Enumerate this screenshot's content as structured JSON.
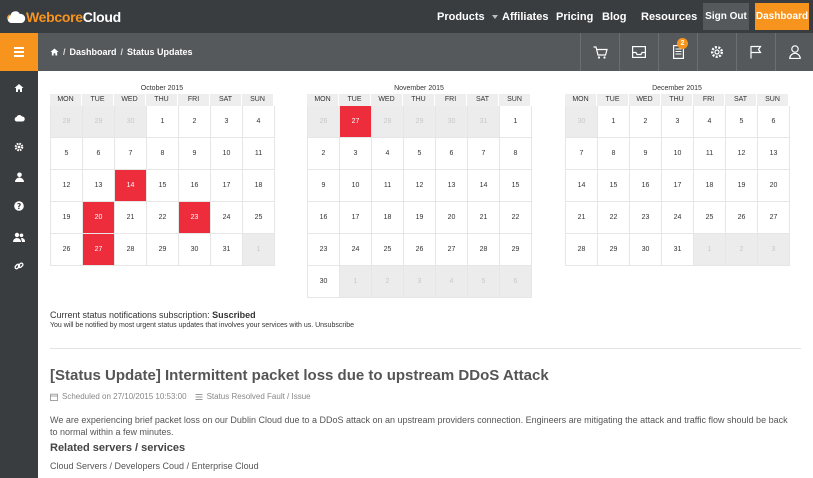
{
  "brand": {
    "word1": "Webcore",
    "word2": "Cloud"
  },
  "nav": {
    "products": "Products",
    "affiliates": "Affiliates",
    "pricing": "Pricing",
    "blog": "Blog",
    "resources": "Resources",
    "signout": "Sign Out",
    "dashboard": "Dashboard"
  },
  "breadcrumb": {
    "home_sep": "/",
    "dashboard": "Dashboard",
    "sep": "/",
    "current": "Status Updates"
  },
  "notifications_badge": "2",
  "colors": {
    "accent": "#f7941d",
    "dark": "#3a3d40",
    "mid": "#55595c",
    "highlight": "#ee2d3c"
  },
  "weekdays": [
    "MON",
    "TUE",
    "WED",
    "THU",
    "FRI",
    "SAT",
    "SUN"
  ],
  "calendars": [
    {
      "title": "October 2015",
      "cells": [
        {
          "d": "28",
          "o": true
        },
        {
          "d": "29",
          "o": true
        },
        {
          "d": "30",
          "o": true
        },
        {
          "d": "1"
        },
        {
          "d": "2"
        },
        {
          "d": "3"
        },
        {
          "d": "4"
        },
        {
          "d": "5"
        },
        {
          "d": "6"
        },
        {
          "d": "7"
        },
        {
          "d": "8"
        },
        {
          "d": "9"
        },
        {
          "d": "10"
        },
        {
          "d": "11"
        },
        {
          "d": "12"
        },
        {
          "d": "13"
        },
        {
          "d": "14",
          "h": true
        },
        {
          "d": "15"
        },
        {
          "d": "16"
        },
        {
          "d": "17"
        },
        {
          "d": "18"
        },
        {
          "d": "19"
        },
        {
          "d": "20",
          "h": true
        },
        {
          "d": "21"
        },
        {
          "d": "22"
        },
        {
          "d": "23",
          "h": true
        },
        {
          "d": "24"
        },
        {
          "d": "25"
        },
        {
          "d": "26"
        },
        {
          "d": "27",
          "h": true
        },
        {
          "d": "28"
        },
        {
          "d": "29"
        },
        {
          "d": "30"
        },
        {
          "d": "31"
        },
        {
          "d": "1",
          "o": true
        }
      ]
    },
    {
      "title": "November 2015",
      "cells": [
        {
          "d": "26",
          "o": true
        },
        {
          "d": "27",
          "h": true
        },
        {
          "d": "28",
          "o": true
        },
        {
          "d": "29",
          "o": true
        },
        {
          "d": "30",
          "o": true
        },
        {
          "d": "31",
          "o": true
        },
        {
          "d": "1"
        },
        {
          "d": "2"
        },
        {
          "d": "3"
        },
        {
          "d": "4"
        },
        {
          "d": "5"
        },
        {
          "d": "6"
        },
        {
          "d": "7"
        },
        {
          "d": "8"
        },
        {
          "d": "9"
        },
        {
          "d": "10"
        },
        {
          "d": "11"
        },
        {
          "d": "12"
        },
        {
          "d": "13"
        },
        {
          "d": "14"
        },
        {
          "d": "15"
        },
        {
          "d": "16"
        },
        {
          "d": "17"
        },
        {
          "d": "18"
        },
        {
          "d": "19"
        },
        {
          "d": "20"
        },
        {
          "d": "21"
        },
        {
          "d": "22"
        },
        {
          "d": "23"
        },
        {
          "d": "24"
        },
        {
          "d": "25"
        },
        {
          "d": "26"
        },
        {
          "d": "27"
        },
        {
          "d": "28"
        },
        {
          "d": "29"
        },
        {
          "d": "30"
        },
        {
          "d": "1",
          "o": true
        },
        {
          "d": "2",
          "o": true
        },
        {
          "d": "3",
          "o": true
        },
        {
          "d": "4",
          "o": true
        },
        {
          "d": "5",
          "o": true
        },
        {
          "d": "6",
          "o": true
        }
      ]
    },
    {
      "title": "December 2015",
      "cells": [
        {
          "d": "30",
          "o": true
        },
        {
          "d": "1"
        },
        {
          "d": "2"
        },
        {
          "d": "3"
        },
        {
          "d": "4"
        },
        {
          "d": "5"
        },
        {
          "d": "6"
        },
        {
          "d": "7"
        },
        {
          "d": "8"
        },
        {
          "d": "9"
        },
        {
          "d": "10"
        },
        {
          "d": "11"
        },
        {
          "d": "12"
        },
        {
          "d": "13"
        },
        {
          "d": "14"
        },
        {
          "d": "15"
        },
        {
          "d": "16"
        },
        {
          "d": "17"
        },
        {
          "d": "18"
        },
        {
          "d": "19"
        },
        {
          "d": "20"
        },
        {
          "d": "21"
        },
        {
          "d": "22"
        },
        {
          "d": "23"
        },
        {
          "d": "24"
        },
        {
          "d": "25"
        },
        {
          "d": "26"
        },
        {
          "d": "27"
        },
        {
          "d": "28"
        },
        {
          "d": "29"
        },
        {
          "d": "30"
        },
        {
          "d": "31"
        },
        {
          "d": "1",
          "o": true
        },
        {
          "d": "2",
          "o": true
        },
        {
          "d": "3",
          "o": true
        }
      ]
    }
  ],
  "subscription": {
    "label": "Current status notifications subscription:",
    "value": "Suscribed",
    "note": "You will be notified by most urgent status updates that involves your services with us.",
    "unsubscribe": "Unsubscribe"
  },
  "update": {
    "title": "[Status Update] Intermittent packet loss due to upstream DDoS Attack",
    "scheduled": "Scheduled on 27/10/2015 10:53:00",
    "status": "Status Resolved Fault / Issue",
    "description": "We are experiencing brief packet loss on our Dublin Cloud due to a DDoS attack on an upstream providers connection. Engineers are mitigating the attack and traffic flow should be back to normal within a few minutes.",
    "related_heading": "Related servers / services",
    "related_value": "Cloud Servers / Developers Coud / Enterprise Cloud"
  }
}
